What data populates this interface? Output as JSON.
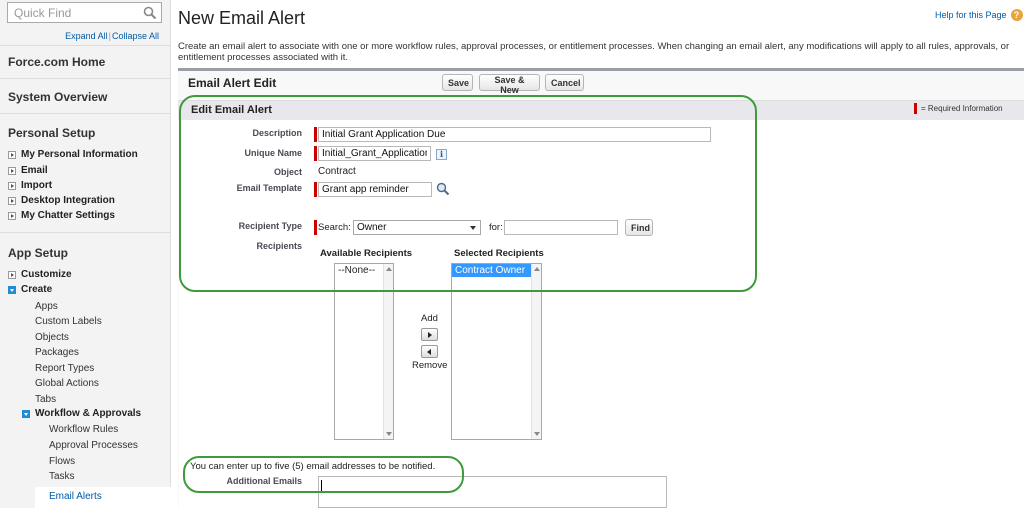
{
  "sidebar": {
    "search_placeholder": "Quick Find",
    "expand_all": "Expand All",
    "separator": "|",
    "collapse_all": "Collapse All",
    "force_home": "Force.com Home",
    "system_overview": "System Overview",
    "personal_setup": {
      "title": "Personal Setup",
      "items": [
        "My Personal Information",
        "Email",
        "Import",
        "Desktop Integration",
        "My Chatter Settings"
      ]
    },
    "app_setup": {
      "title": "App Setup",
      "customize": "Customize",
      "create": "Create",
      "create_children": [
        "Apps",
        "Custom Labels",
        "Objects",
        "Packages",
        "Report Types",
        "Global Actions",
        "Tabs"
      ],
      "workflow": "Workflow & Approvals",
      "workflow_children": [
        "Workflow Rules",
        "Approval Processes",
        "Flows",
        "Tasks",
        "Email Alerts"
      ],
      "selected": "Email Alerts"
    }
  },
  "page": {
    "title": "New Email Alert",
    "help_link": "Help for this Page",
    "help_icon_glyph": "?",
    "intro": "Create an email alert to associate with one or more workflow rules, approval processes, or entitlement processes. When changing an email alert, any modifications will apply to all rules, approvals, or entitlement processes associated with it."
  },
  "edit": {
    "header": "Email Alert Edit",
    "buttons": {
      "save": "Save",
      "save_new": "Save & New",
      "cancel": "Cancel"
    },
    "section_title": "Edit Email Alert",
    "required_info": "= Required Information"
  },
  "form": {
    "description_label": "Description",
    "description_value": "Initial Grant Application Due",
    "unique_name_label": "Unique Name",
    "unique_name_value": "Initial_Grant_Application",
    "info_glyph": "i",
    "object_label": "Object",
    "object_value": "Contract",
    "template_label": "Email Template",
    "template_value": "Grant app reminder",
    "recipient_type_label": "Recipient Type",
    "search_label": "Search:",
    "search_select_value": "Owner",
    "for_label": "for:",
    "for_value": "",
    "find_button": "Find",
    "recipients_label": "Recipients",
    "available_header": "Available Recipients",
    "available_options": [
      "--None--"
    ],
    "selected_header": "Selected Recipients",
    "selected_options": [
      "Contract Owner"
    ],
    "add_label": "Add",
    "remove_label": "Remove",
    "additional_note": "You can enter up to five (5) email addresses to be notified.",
    "additional_emails_label": "Additional Emails",
    "additional_emails_value": ""
  },
  "colors": {
    "link": "#015ba7",
    "required": "#cc0000",
    "highlight": "#3d9a3d",
    "selected_option": "#3399ff",
    "section_bar": "#e8e8ec"
  },
  "icons": {
    "search": "search-icon",
    "help": "help-icon",
    "lookup": "lookup-icon",
    "info": "info-icon",
    "add_arrow": "arrow-right-icon",
    "remove_arrow": "arrow-left-icon"
  }
}
